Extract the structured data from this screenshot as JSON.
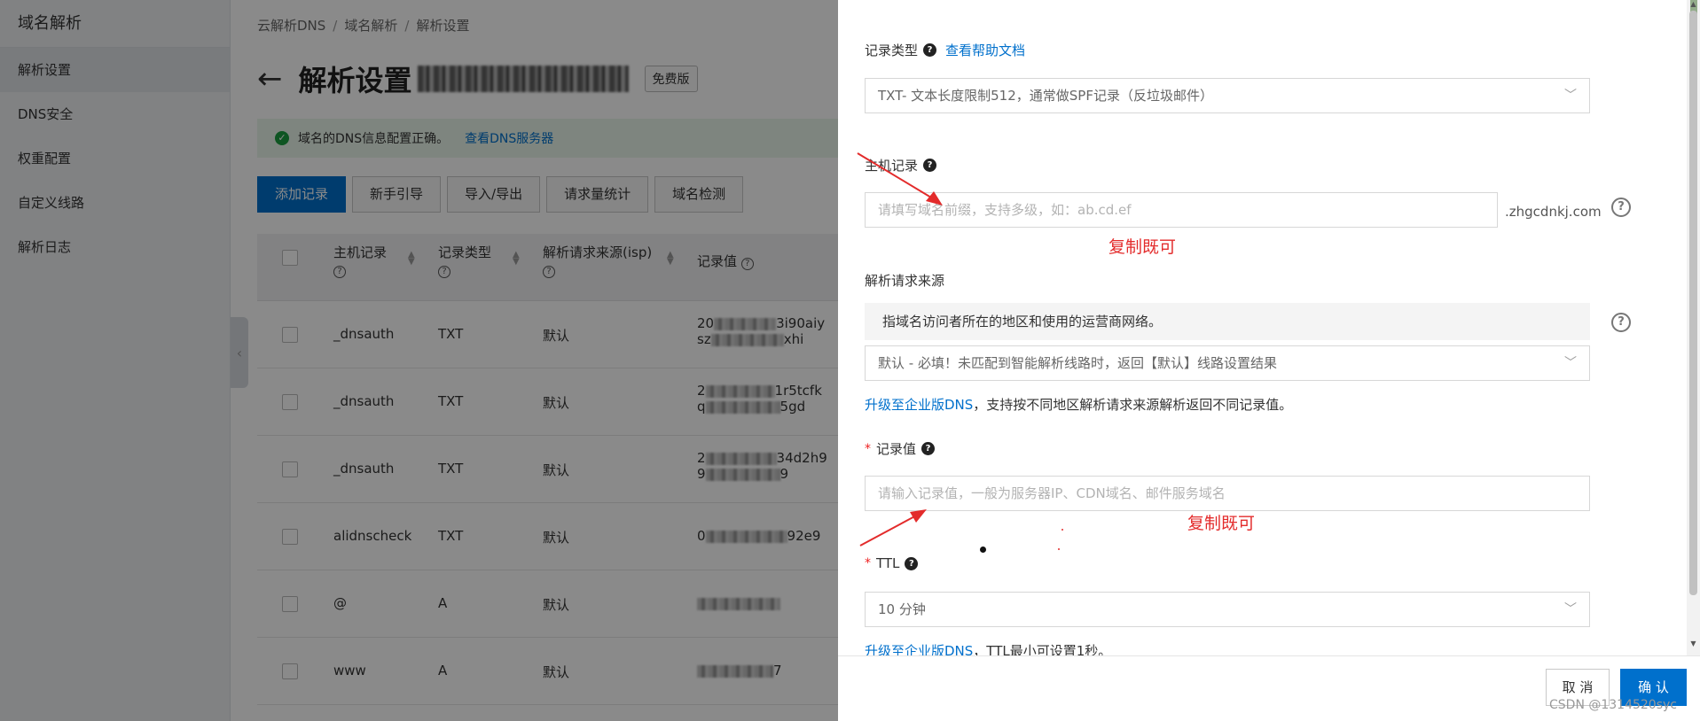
{
  "sidebar": {
    "title": "域名解析",
    "items": [
      {
        "label": "解析设置",
        "active": true
      },
      {
        "label": "DNS安全"
      },
      {
        "label": "权重配置"
      },
      {
        "label": "自定义线路"
      },
      {
        "label": "解析日志"
      }
    ]
  },
  "breadcrumb": [
    "云解析DNS",
    "解析设置"
  ],
  "header": {
    "title": "解析设置",
    "badge": "免费版"
  },
  "alert": {
    "text": "域名的DNS信息配置正确。",
    "link": "查看DNS服务器"
  },
  "actions": [
    "添加记录",
    "新手引导",
    "导入/导出",
    "请求量统计",
    "域名检测"
  ],
  "table": {
    "headers": [
      "主机记录",
      "记录类型",
      "解析请求来源(isp)",
      "记录值"
    ],
    "rows": [
      {
        "host": "_dnsauth",
        "type": "TXT",
        "isp": "默认",
        "value1": "20",
        "value1b": "3i90aiy",
        "value2": "sz",
        "value2b": "xhi"
      },
      {
        "host": "_dnsauth",
        "type": "TXT",
        "isp": "默认",
        "value1": "2",
        "value1b": "1r5tcfk",
        "value2": "q",
        "value2b": "5gd"
      },
      {
        "host": "_dnsauth",
        "type": "TXT",
        "isp": "默认",
        "value1": "2",
        "value1b": "34d2h9",
        "value2": "9",
        "value2b": "9"
      },
      {
        "host": "alidnscheck",
        "type": "TXT",
        "isp": "默认",
        "value1": "0",
        "value1b": "92e9"
      },
      {
        "host": "@",
        "type": "A",
        "isp": "默认",
        "value1": "",
        "value1b": ""
      },
      {
        "host": "www",
        "type": "A",
        "isp": "默认",
        "value1": "",
        "value1b": "7"
      }
    ]
  },
  "drawer": {
    "record_type": {
      "label": "记录类型",
      "help_link": "查看帮助文档",
      "value": "TXT- 文本长度限制512，通常做SPF记录（反垃圾邮件）"
    },
    "host_record": {
      "label": "主机记录",
      "placeholder": "请填写域名前缀，支持多级，如：ab.cd.ef",
      "suffix": ".zhgcdnkj.com"
    },
    "source": {
      "label": "解析请求来源",
      "hint": "指域名访问者所在的地区和使用的运营商网络。",
      "value": "默认 - 必填！未匹配到智能解析线路时，返回【默认】线路设置结果",
      "upgrade_link": "升级至企业版DNS",
      "upgrade_note": "，支持按不同地区解析请求来源解析返回不同记录值。"
    },
    "record_value": {
      "label": "记录值",
      "placeholder": "请输入记录值，一般为服务器IP、CDN域名、邮件服务域名"
    },
    "ttl": {
      "label": "TTL",
      "value": "10 分钟",
      "upgrade_link": "升级至企业版DNS",
      "upgrade_note": "，TTL最小可设置1秒。"
    },
    "cancel_label": "取 消",
    "ok_label": "确 认"
  },
  "annotations": {
    "copy1": "复制既可",
    "copy2": "复制既可"
  },
  "watermark": "CSDN @1314520syc",
  "colors": {
    "primary": "#0070cc",
    "annotation": "#e32b2b",
    "success": "#1a9e3f"
  }
}
